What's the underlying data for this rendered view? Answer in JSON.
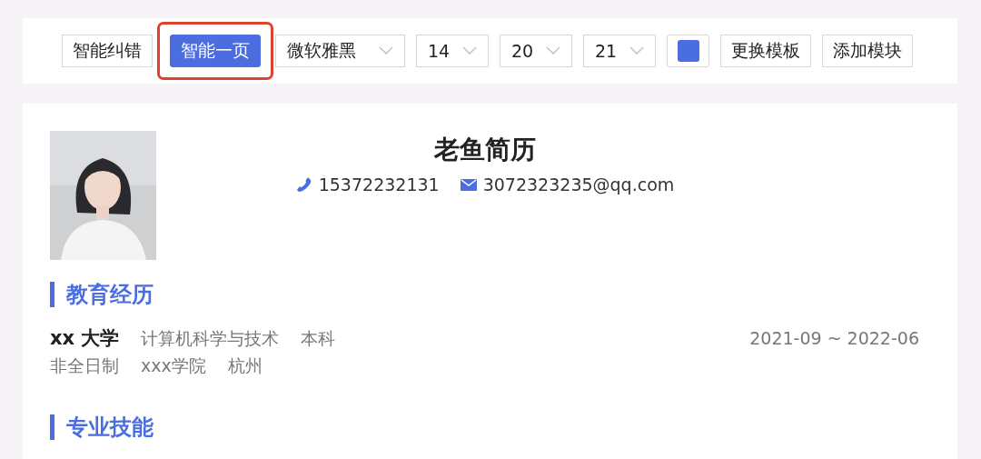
{
  "toolbar": {
    "items": [
      {
        "kind": "button",
        "label": "智能纠错",
        "active": false,
        "highlighted": false
      },
      {
        "kind": "button",
        "label": "智能一页",
        "active": true,
        "highlighted": true
      },
      {
        "kind": "dropdown",
        "value": "微软雅黑"
      },
      {
        "kind": "dropdown",
        "value": "14"
      },
      {
        "kind": "dropdown",
        "value": "20"
      },
      {
        "kind": "dropdown",
        "value": "21"
      },
      {
        "kind": "color",
        "color": "#4a6ee0"
      },
      {
        "kind": "button",
        "label": "更换模板",
        "active": false,
        "highlighted": false
      },
      {
        "kind": "button",
        "label": "添加模块",
        "active": false,
        "highlighted": false
      }
    ]
  },
  "resume": {
    "name": "老鱼简历",
    "contacts": [
      {
        "kind": "phone",
        "text": "15372232131"
      },
      {
        "kind": "email",
        "text": "3072323235@qq.com"
      }
    ],
    "sections": [
      {
        "title": "教育经历",
        "entries": [
          {
            "school": "xx 大学",
            "details": [
              "计算机科学与技术",
              "本科"
            ],
            "dates": "2021-09 ~ 2022-06",
            "extra": [
              "非全日制",
              "xxx学院",
              "杭州"
            ]
          }
        ]
      },
      {
        "title": "专业技能"
      }
    ]
  }
}
